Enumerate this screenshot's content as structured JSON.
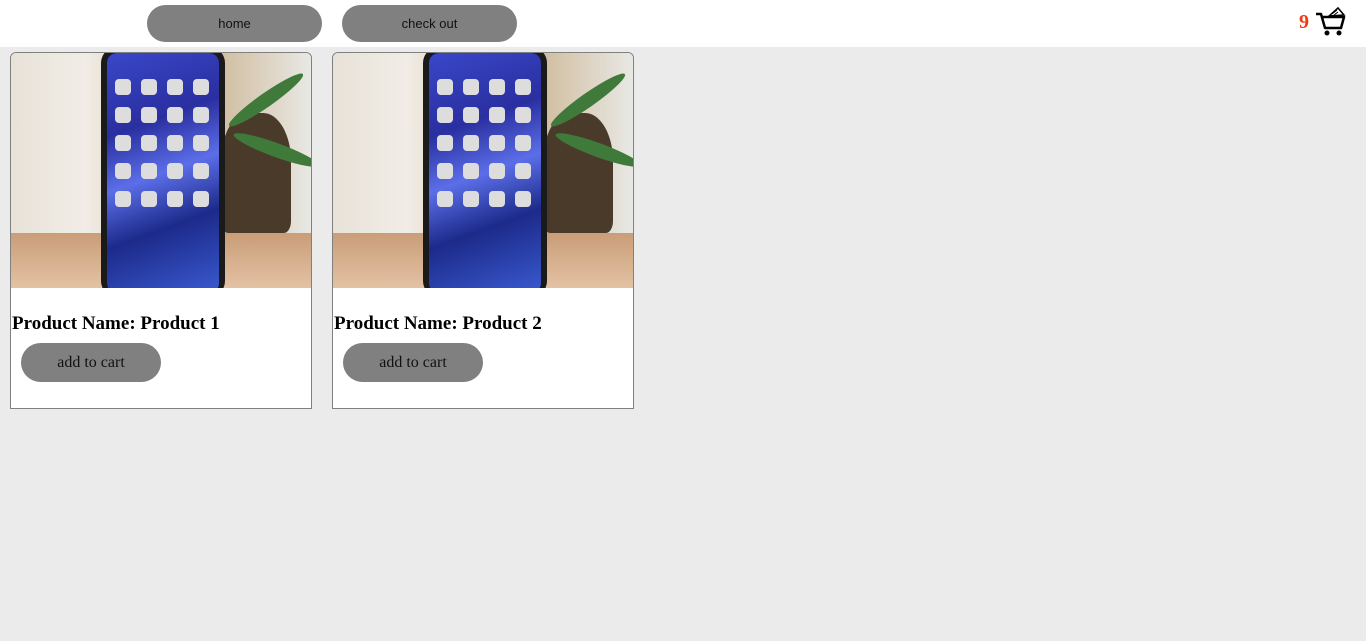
{
  "nav": {
    "home_label": "home",
    "checkout_label": "check out"
  },
  "cart": {
    "count": "9",
    "icon": "shopping-cart-icon",
    "count_color": "#f03a10"
  },
  "products": [
    {
      "name": "Product Name: Product 1",
      "button_label": "add to cart",
      "image": "iphone-photo"
    },
    {
      "name": "Product Name: Product 2",
      "button_label": "add to cart",
      "image": "iphone-photo"
    }
  ]
}
